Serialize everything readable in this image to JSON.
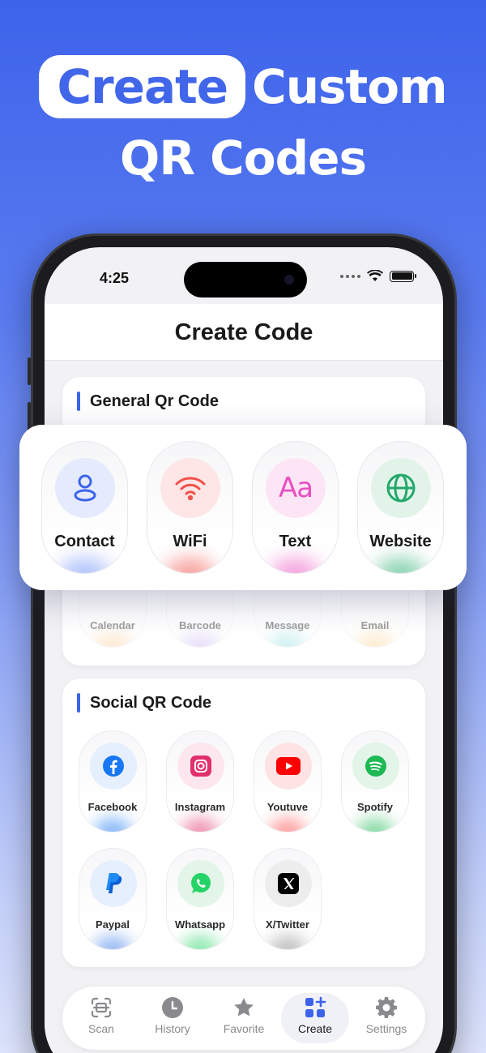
{
  "headline": {
    "highlight": "Create",
    "rest": "Custom",
    "line2": "QR Codes"
  },
  "status": {
    "time": "4:25"
  },
  "appbar": {
    "title": "Create Code"
  },
  "general": {
    "title": "General Qr Code",
    "featured": [
      {
        "label": "Contact",
        "icon": "contact-icon",
        "color": "#3d63ea"
      },
      {
        "label": "WiFi",
        "icon": "wifi-icon",
        "color": "#f0504a"
      },
      {
        "label": "Text",
        "icon": "text-icon",
        "color": "#e94fbf"
      },
      {
        "label": "Website",
        "icon": "globe-icon",
        "color": "#22a86a"
      }
    ],
    "more": [
      {
        "label": "Calendar"
      },
      {
        "label": "Barcode"
      },
      {
        "label": "Message"
      },
      {
        "label": "Email"
      }
    ]
  },
  "social": {
    "title": "Social QR Code",
    "items": [
      {
        "label": "Facebook",
        "icon": "facebook-icon",
        "color": "#1877f2"
      },
      {
        "label": "Instagram",
        "icon": "instagram-icon",
        "color": "#e1306c"
      },
      {
        "label": "Youtuve",
        "icon": "youtube-icon",
        "color": "#ff0000"
      },
      {
        "label": "Spotify",
        "icon": "spotify-icon",
        "color": "#1db954"
      },
      {
        "label": "Paypal",
        "icon": "paypal-icon",
        "color": "#0a5fd6"
      },
      {
        "label": "Whatsapp",
        "icon": "whatsapp-icon",
        "color": "#25d366"
      },
      {
        "label": "X/Twitter",
        "icon": "x-twitter-icon",
        "color": "#000000"
      }
    ]
  },
  "tabs": [
    {
      "label": "Scan",
      "icon": "scan-icon"
    },
    {
      "label": "History",
      "icon": "history-icon"
    },
    {
      "label": "Favorite",
      "icon": "star-icon"
    },
    {
      "label": "Create",
      "icon": "create-icon",
      "active": true
    },
    {
      "label": "Settings",
      "icon": "gear-icon"
    }
  ],
  "colors": {
    "accent": "#3d63ea"
  }
}
